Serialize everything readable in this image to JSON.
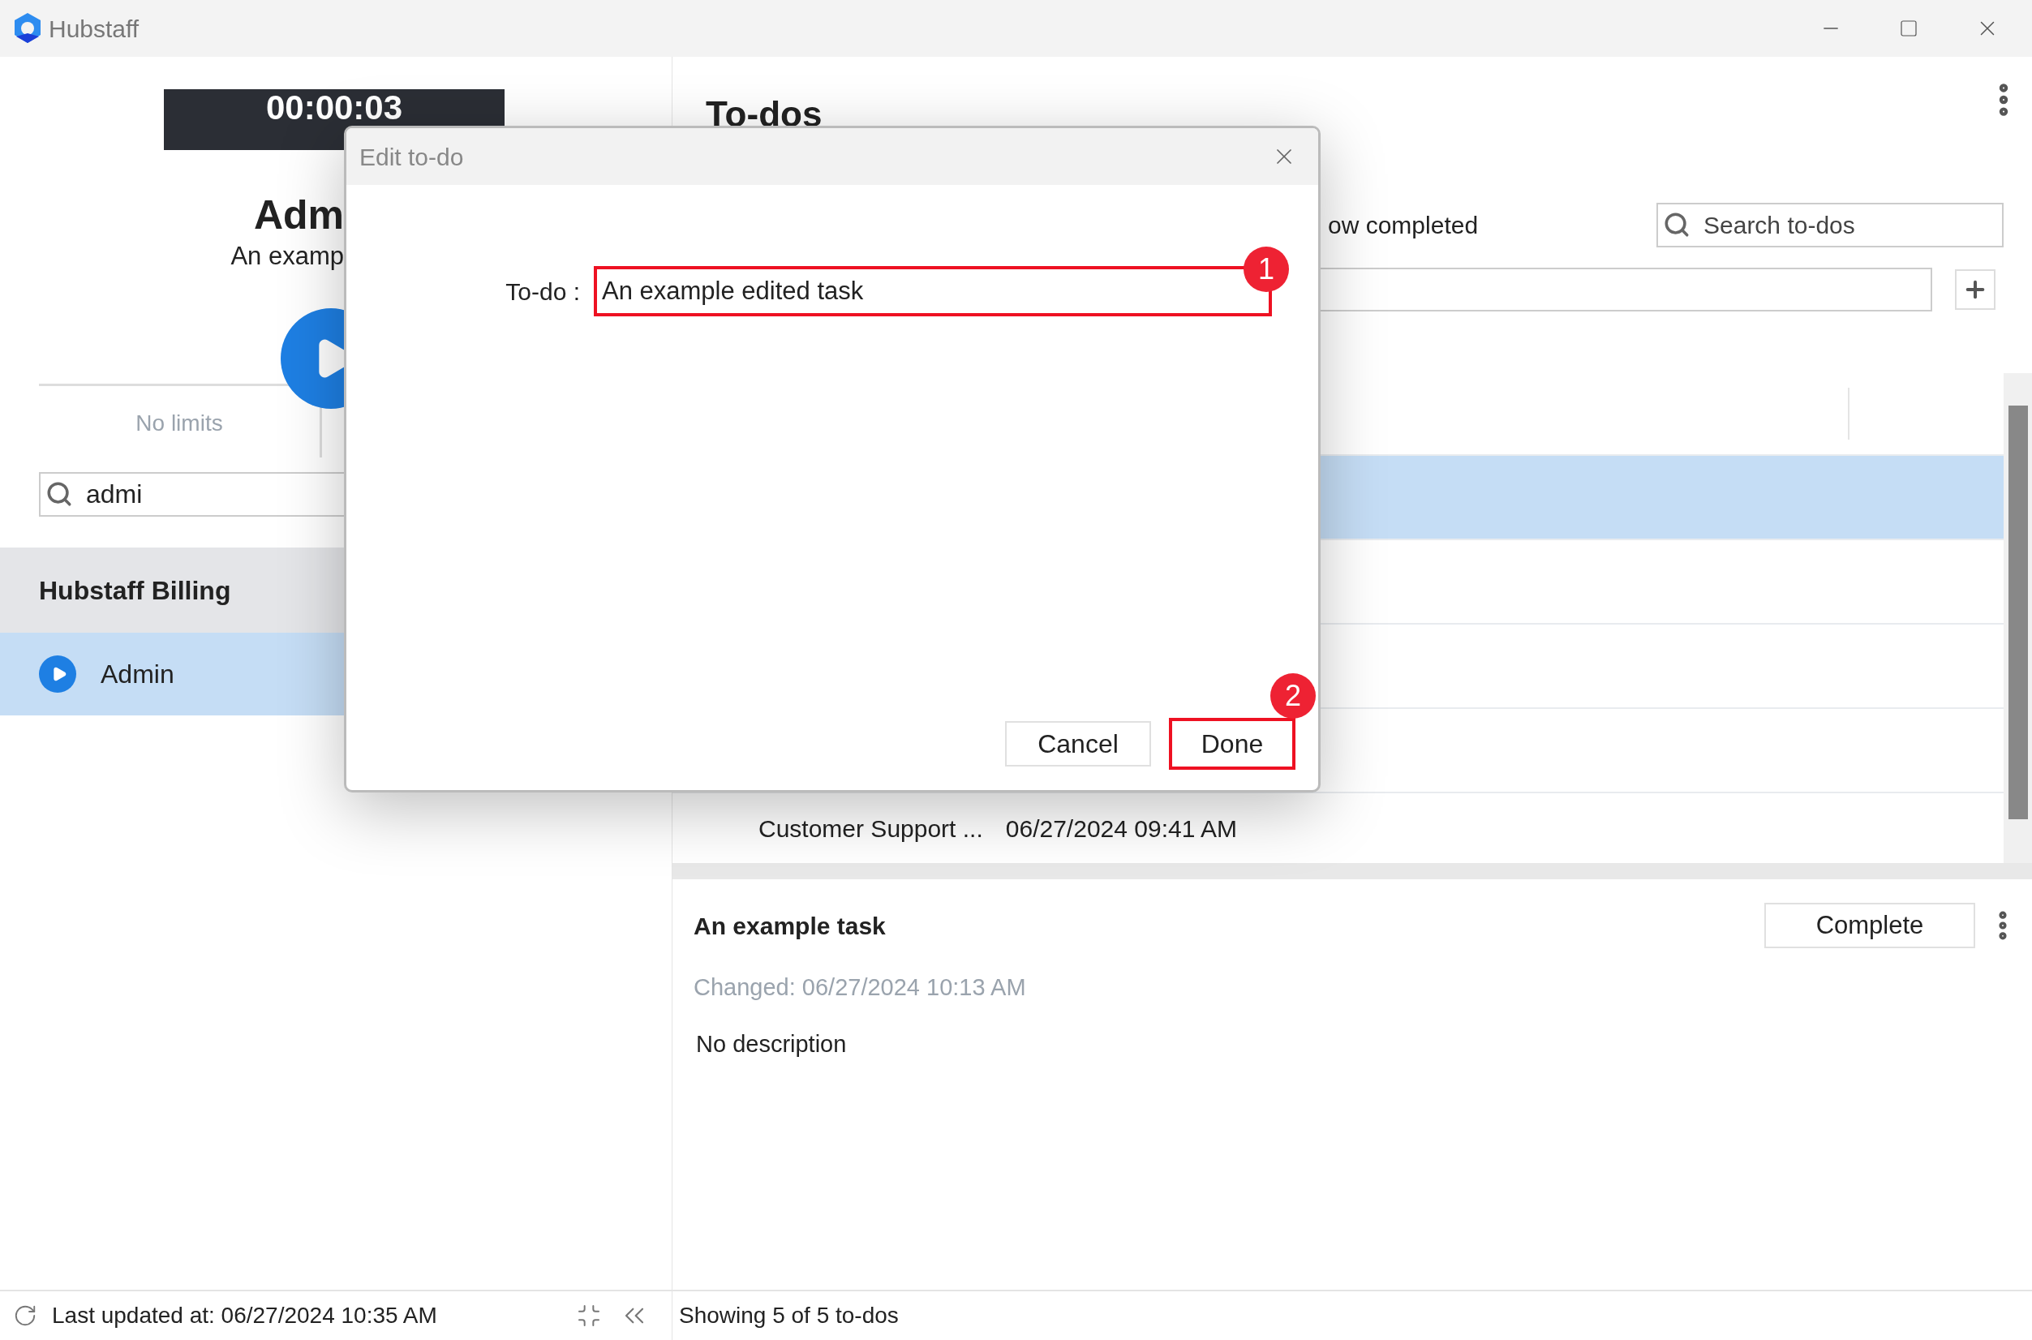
{
  "window": {
    "title": "Hubstaff"
  },
  "timer": {
    "time": "00:00:03"
  },
  "project_header": {
    "name": "Adm",
    "task": "An examp"
  },
  "limits": {
    "text": "No limits"
  },
  "project_search": {
    "value": "admi"
  },
  "projects": [
    {
      "group": "Hubstaff Billing",
      "items": [
        {
          "name": "Admin",
          "selected": true
        }
      ]
    }
  ],
  "left_status": {
    "text": "Last updated at: 06/27/2024 10:35 AM"
  },
  "todos": {
    "title": "To-dos",
    "show_completed_label": "ow completed",
    "search": {
      "placeholder": "Search to-dos"
    },
    "rows": [
      {
        "selected": true
      },
      {
        "selected": false
      },
      {
        "selected": false
      },
      {
        "selected": false
      },
      {
        "selected": false,
        "cells": [
          "Customer Support ...",
          "06/27/2024 09:41 AM"
        ]
      }
    ]
  },
  "detail": {
    "title": "An example task",
    "complete_button": "Complete",
    "changed": "Changed: 06/27/2024 10:13 AM",
    "description": "No description"
  },
  "right_status": {
    "text": "Showing 5 of 5 to-dos"
  },
  "dialog": {
    "title": "Edit to-do",
    "label": "To-do :",
    "value": "An example edited task",
    "buttons": [
      "Cancel",
      "Done"
    ],
    "annotations": [
      "1",
      "2"
    ]
  }
}
